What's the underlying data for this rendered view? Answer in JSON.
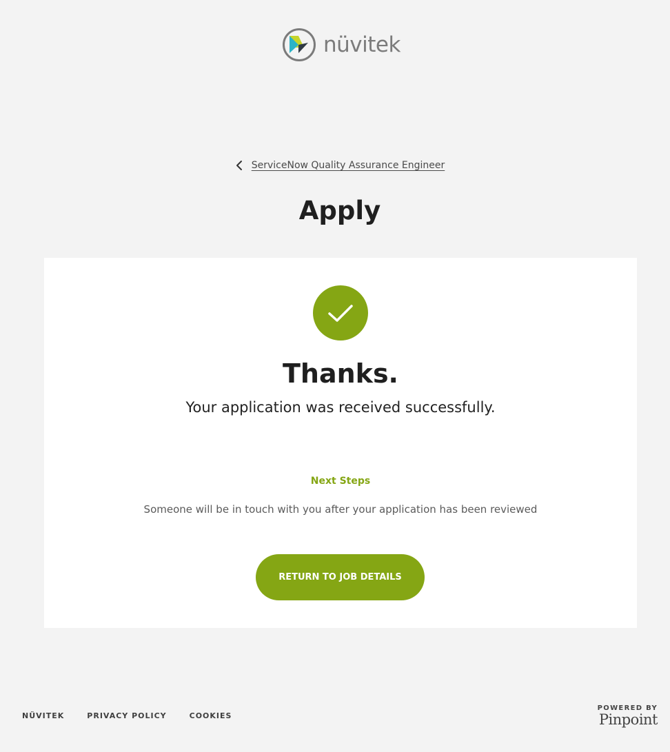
{
  "brand": {
    "name": "nüvitek",
    "accent_color": "#85a614",
    "logo_colors": [
      "#c6d42a",
      "#2bb3c7",
      "#7b7b7b"
    ]
  },
  "breadcrumb": {
    "icon": "chevron-left-icon",
    "label": "ServiceNow Quality Assurance Engineer"
  },
  "page": {
    "title": "Apply"
  },
  "confirmation": {
    "icon": "check-icon",
    "heading": "Thanks.",
    "message": "Your application was received successfully.",
    "next_steps_title": "Next Steps",
    "next_steps_text": "Someone will be in touch with you after your application has been reviewed",
    "return_button": "RETURN TO JOB DETAILS"
  },
  "footer": {
    "links": [
      "NÜVITEK",
      "PRIVACY POLICY",
      "COOKIES"
    ],
    "powered_by": "POWERED BY",
    "powered_brand": "Pinpoint"
  }
}
